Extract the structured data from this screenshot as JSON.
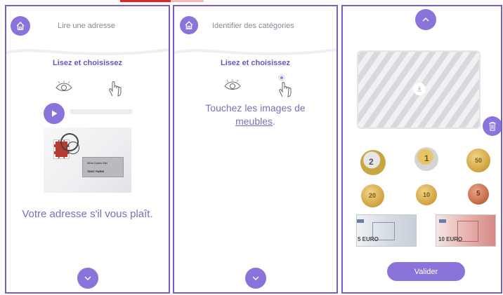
{
  "panels": [
    {
      "header_title": "Lire une adresse",
      "subtitle": "Lisez et choisissez",
      "envelope": {
        "name": "Mme Dyaks Biel",
        "postcode_city": "75007 PARIS"
      },
      "main_text": "Votre adresse s'il vous plaît."
    },
    {
      "header_title": "Identifier des catégories",
      "subtitle": "Lisez et choisissez",
      "instruction_line1": "Touchez les images de",
      "instruction_link": "meubles",
      "instruction_end": "."
    },
    {
      "coins": [
        "2",
        "1",
        "50",
        "20",
        "10",
        "5"
      ],
      "banknotes": [
        "5 EURO",
        "10 EURO"
      ],
      "validate_label": "Valider"
    }
  ],
  "icons": {
    "home": "home-icon",
    "eye": "eye-icon",
    "hand": "hand-pointer-icon",
    "play": "play-icon",
    "chevron_down": "chevron-down-icon",
    "chevron_up": "chevron-up-icon",
    "trash": "trash-icon",
    "download": "download-icon"
  },
  "colors": {
    "accent": "#8b73dc",
    "border": "#7a5cc8",
    "heading": "#6a55c0",
    "text": "#7a70b8"
  }
}
